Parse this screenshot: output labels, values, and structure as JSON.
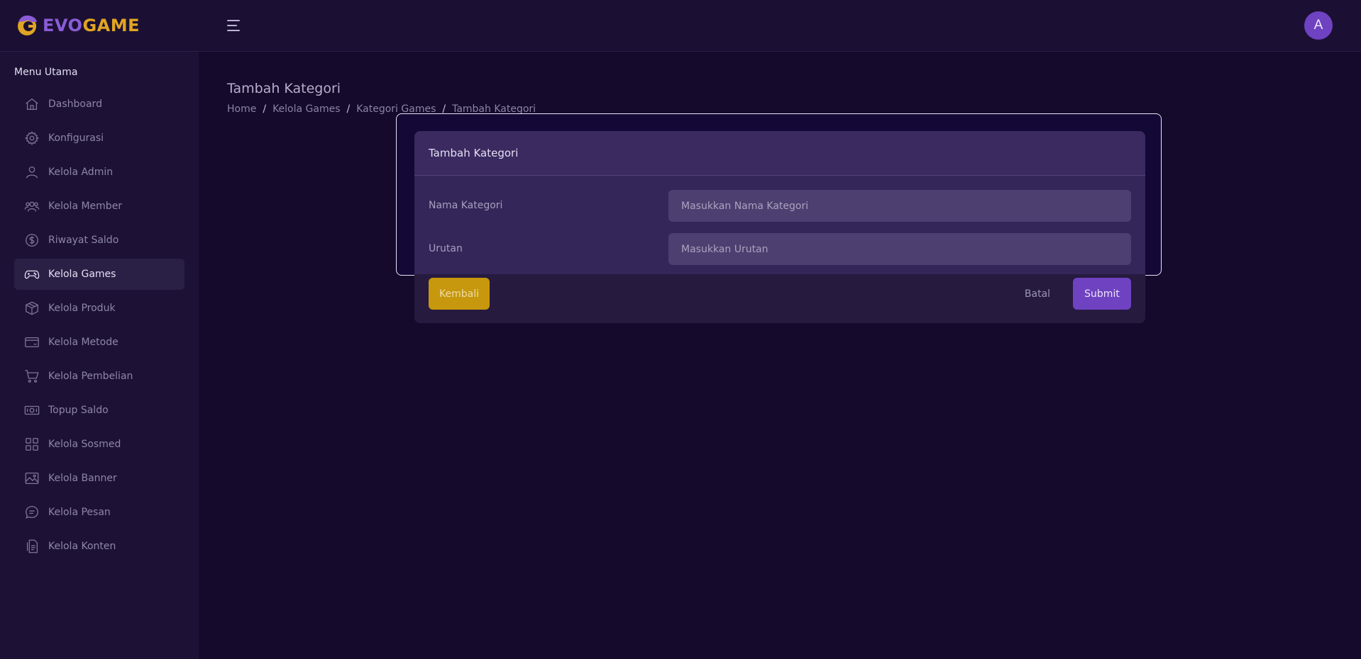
{
  "app": {
    "brand_part1": "EVO",
    "brand_part2": "GAME",
    "avatar_initial": "A",
    "colors": {
      "brand_purple": "#8a5cd6",
      "brand_gold": "#e0a523",
      "accent": "#6f42c1",
      "back_button": "#c7980d",
      "background": "#150a2b"
    }
  },
  "header": {
    "menu_toggle_icon": "hamburger-icon"
  },
  "sidebar": {
    "heading": "Menu Utama",
    "items": [
      {
        "label": "Dashboard",
        "icon": "home-icon",
        "active": false
      },
      {
        "label": "Konfigurasi",
        "icon": "gear-icon",
        "active": false
      },
      {
        "label": "Kelola Admin",
        "icon": "user-icon",
        "active": false
      },
      {
        "label": "Kelola Member",
        "icon": "users-icon",
        "active": false
      },
      {
        "label": "Riwayat Saldo",
        "icon": "dollar-circle-icon",
        "active": false
      },
      {
        "label": "Kelola Games",
        "icon": "gamepad-icon",
        "active": true
      },
      {
        "label": "Kelola Produk",
        "icon": "box-icon",
        "active": false
      },
      {
        "label": "Kelola Metode",
        "icon": "credit-card-icon",
        "active": false
      },
      {
        "label": "Kelola Pembelian",
        "icon": "cart-icon",
        "active": false
      },
      {
        "label": "Topup Saldo",
        "icon": "cash-icon",
        "active": false
      },
      {
        "label": "Kelola Sosmed",
        "icon": "grid-icon",
        "active": false
      },
      {
        "label": "Kelola Banner",
        "icon": "image-icon",
        "active": false
      },
      {
        "label": "Kelola Pesan",
        "icon": "chat-icon",
        "active": false
      },
      {
        "label": "Kelola Konten",
        "icon": "document-icon",
        "active": false
      }
    ]
  },
  "page": {
    "title": "Tambah Kategori",
    "breadcrumb": [
      "Home",
      "Kelola Games",
      "Kategori Games",
      "Tambah Kategori"
    ]
  },
  "form": {
    "title": "Tambah Kategori",
    "fields": [
      {
        "label": "Nama Kategori",
        "placeholder": "Masukkan Nama Kategori",
        "value": ""
      },
      {
        "label": "Urutan",
        "placeholder": "Masukkan Urutan",
        "value": ""
      }
    ],
    "back_label": "Kembali",
    "cancel_label": "Batal",
    "submit_label": "Submit"
  }
}
